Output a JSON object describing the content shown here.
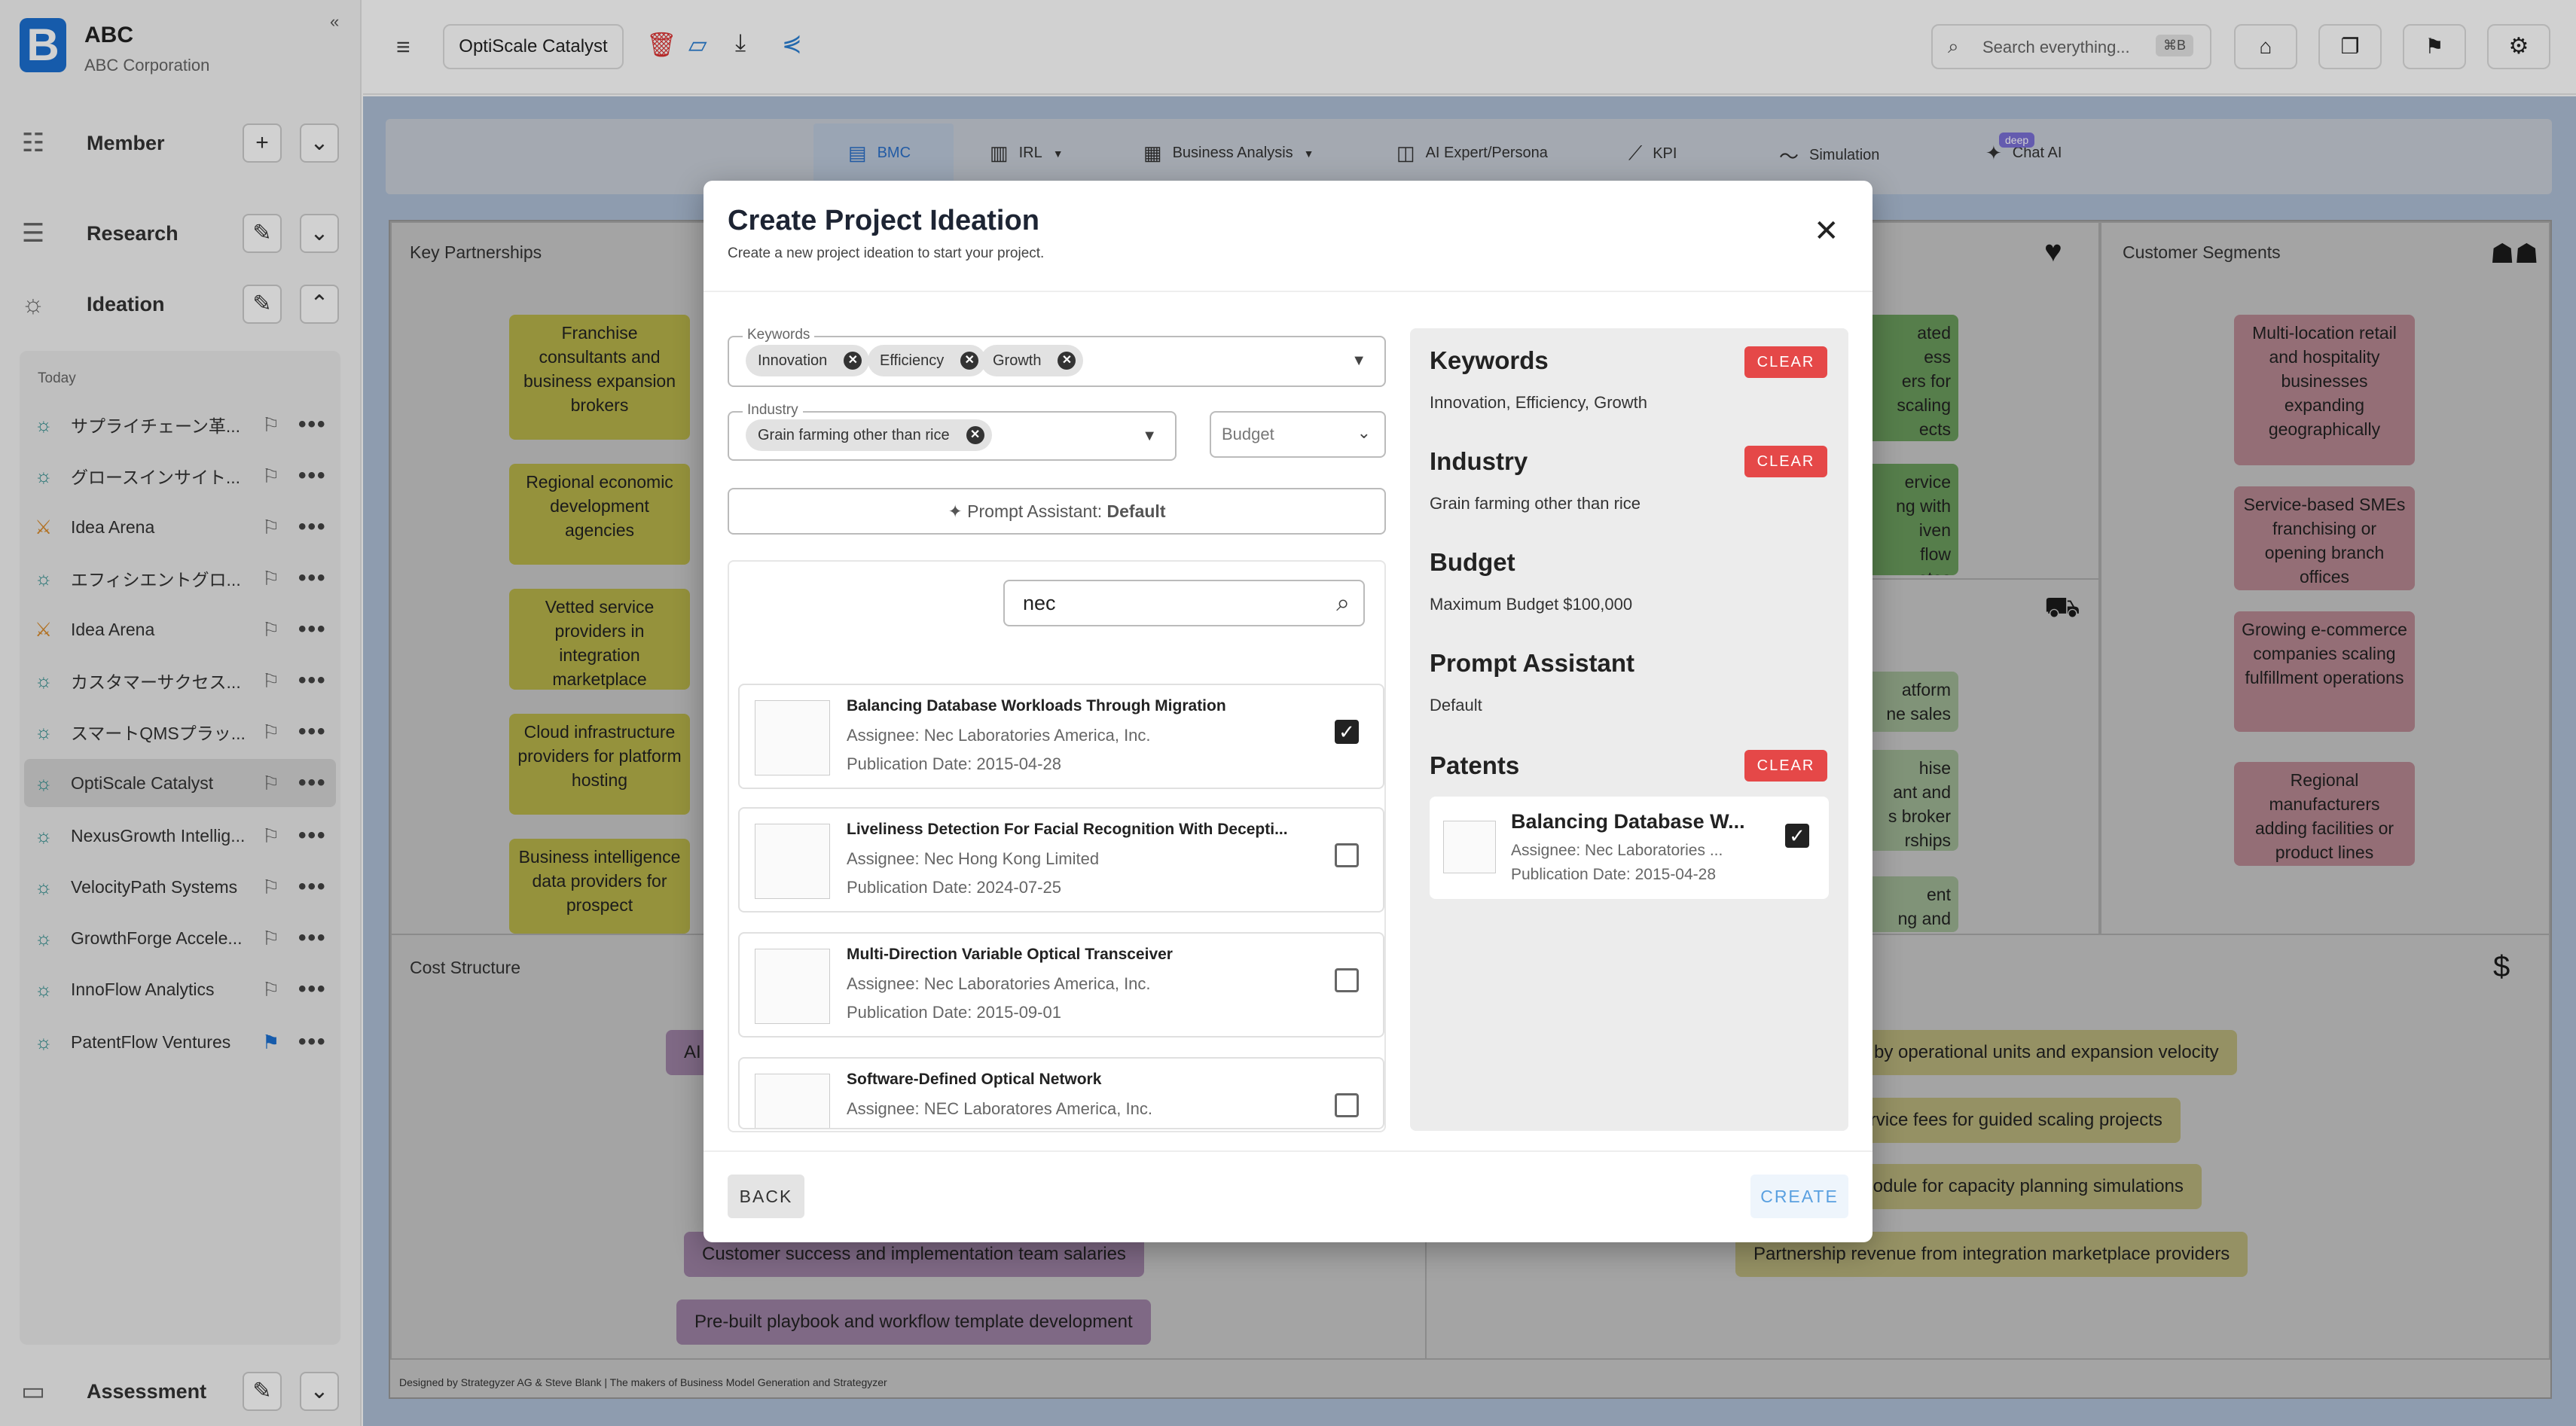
{
  "sidebar": {
    "org_name": "ABC",
    "org_full": "ABC Corporation",
    "sections": {
      "member": "Member",
      "research": "Research",
      "ideation": "Ideation",
      "assessment": "Assessment"
    },
    "today": "Today",
    "items": [
      {
        "label": "サプライチェーン革...",
        "icon": "bulb-icon"
      },
      {
        "label": "グロースインサイト...",
        "icon": "bulb-icon"
      },
      {
        "label": "Idea Arena",
        "icon": "swords-icon"
      },
      {
        "label": "エフィシエントグロ...",
        "icon": "bulb-icon"
      },
      {
        "label": "Idea Arena",
        "icon": "swords-icon"
      },
      {
        "label": "カスタマーサクセス...",
        "icon": "bulb-icon"
      },
      {
        "label": "スマートQMSプラッ...",
        "icon": "bulb-icon"
      },
      {
        "label": "OptiScale Catalyst",
        "icon": "bulb-icon",
        "selected": true
      },
      {
        "label": "NexusGrowth Intellig...",
        "icon": "bulb-icon"
      },
      {
        "label": "VelocityPath Systems",
        "icon": "bulb-icon"
      },
      {
        "label": "GrowthForge Accele...",
        "icon": "bulb-icon"
      },
      {
        "label": "InnoFlow Analytics",
        "icon": "bulb-icon"
      },
      {
        "label": "PatentFlow Ventures",
        "icon": "bulb-icon",
        "bookmarked": true
      }
    ]
  },
  "topbar": {
    "project_name": "OptiScale Catalyst",
    "search_placeholder": "Search everything...",
    "search_shortcut": "⌘B"
  },
  "tabs": [
    "BMC",
    "IRL",
    "Business Analysis",
    "AI Expert/Persona",
    "KPI",
    "Simulation",
    "Chat AI"
  ],
  "tab_badge": "deep",
  "bmc": {
    "key_partnerships": "Key Partnerships",
    "customer_segments": "Customer Segments",
    "cost_structure": "Cost Structure",
    "kp_stickies": [
      "Franchise consultants and business expansion brokers",
      "Regional economic development agencies",
      "Vetted service providers in integration marketplace",
      "Cloud infrastructure providers for platform hosting",
      "Business intelligence data providers for prospect"
    ],
    "cs_stickies": [
      "Multi-location retail and hospitality businesses expanding geographically",
      "Service-based SMEs franchising or opening branch offices",
      "Growing e-commerce companies scaling fulfillment operations",
      "Regional manufacturers adding facilities or product lines"
    ],
    "vp_partial": [
      "ated\ness\ners for\nscaling\nects",
      "ervice\nng with\niven\nflow\nates"
    ],
    "ch_partial": [
      "atform\nne sales",
      "hise\nant and\ns broker\nrships",
      "ent\nng and"
    ],
    "cost_pills": [
      "AI",
      "Customer success and implementation team salaries",
      "Pre-built playbook and workflow template development"
    ],
    "rev_pills": [
      "iption by operational units and expansion velocity",
      "on service fees for guided scaling projects",
      "tics module for capacity planning simulations",
      "Partnership revenue from integration marketplace providers"
    ],
    "footer": "Designed by Strategyzer AG & Steve Blank | The makers of Business Model Generation and Strategyzer"
  },
  "modal": {
    "title": "Create Project Ideation",
    "subtitle": "Create a new project ideation to start your project.",
    "keywords_label": "Keywords",
    "keywords": [
      "Innovation",
      "Efficiency",
      "Growth"
    ],
    "industry_label": "Industry",
    "industry": "Grain farming other than rice",
    "budget_placeholder": "Budget",
    "prompt_label": "Prompt Assistant:",
    "prompt_value": "Default",
    "search_value": "nec",
    "patents": [
      {
        "title": "Balancing Database Workloads Through Migration",
        "assignee": "Assignee: Nec Laboratories America, Inc.",
        "date": "Publication Date: 2015-04-28",
        "checked": true
      },
      {
        "title": "Liveliness Detection For Facial Recognition With Decepti...",
        "assignee": "Assignee: Nec Hong Kong Limited",
        "date": "Publication Date: 2024-07-25",
        "checked": false
      },
      {
        "title": "Multi-Direction Variable Optical Transceiver",
        "assignee": "Assignee: Nec Laboratories America, Inc.",
        "date": "Publication Date: 2015-09-01",
        "checked": false
      },
      {
        "title": "Software-Defined Optical Network",
        "assignee": "Assignee: NEC Laboratores America, Inc.",
        "date": "",
        "checked": false
      }
    ],
    "summary": {
      "keywords_h": "Keywords",
      "keywords_v": "Innovation, Efficiency, Growth",
      "industry_h": "Industry",
      "industry_v": "Grain farming other than rice",
      "budget_h": "Budget",
      "budget_v": "Maximum Budget $100,000",
      "prompt_h": "Prompt Assistant",
      "prompt_v": "Default",
      "patents_h": "Patents",
      "patent_title": "Balancing Database W...",
      "patent_assignee": "Assignee: Nec Laboratories ...",
      "patent_date": "Publication Date: 2015-04-28",
      "clear": "CLEAR"
    },
    "back": "BACK",
    "create": "CREATE"
  },
  "colors": {
    "accent": "#1b6fd1",
    "danger": "#e54848",
    "sticky_yellow": "#e5e05c",
    "sticky_green": "#86c073",
    "sticky_pink": "#e5a3ad",
    "sticky_purple": "#c29fcc"
  }
}
